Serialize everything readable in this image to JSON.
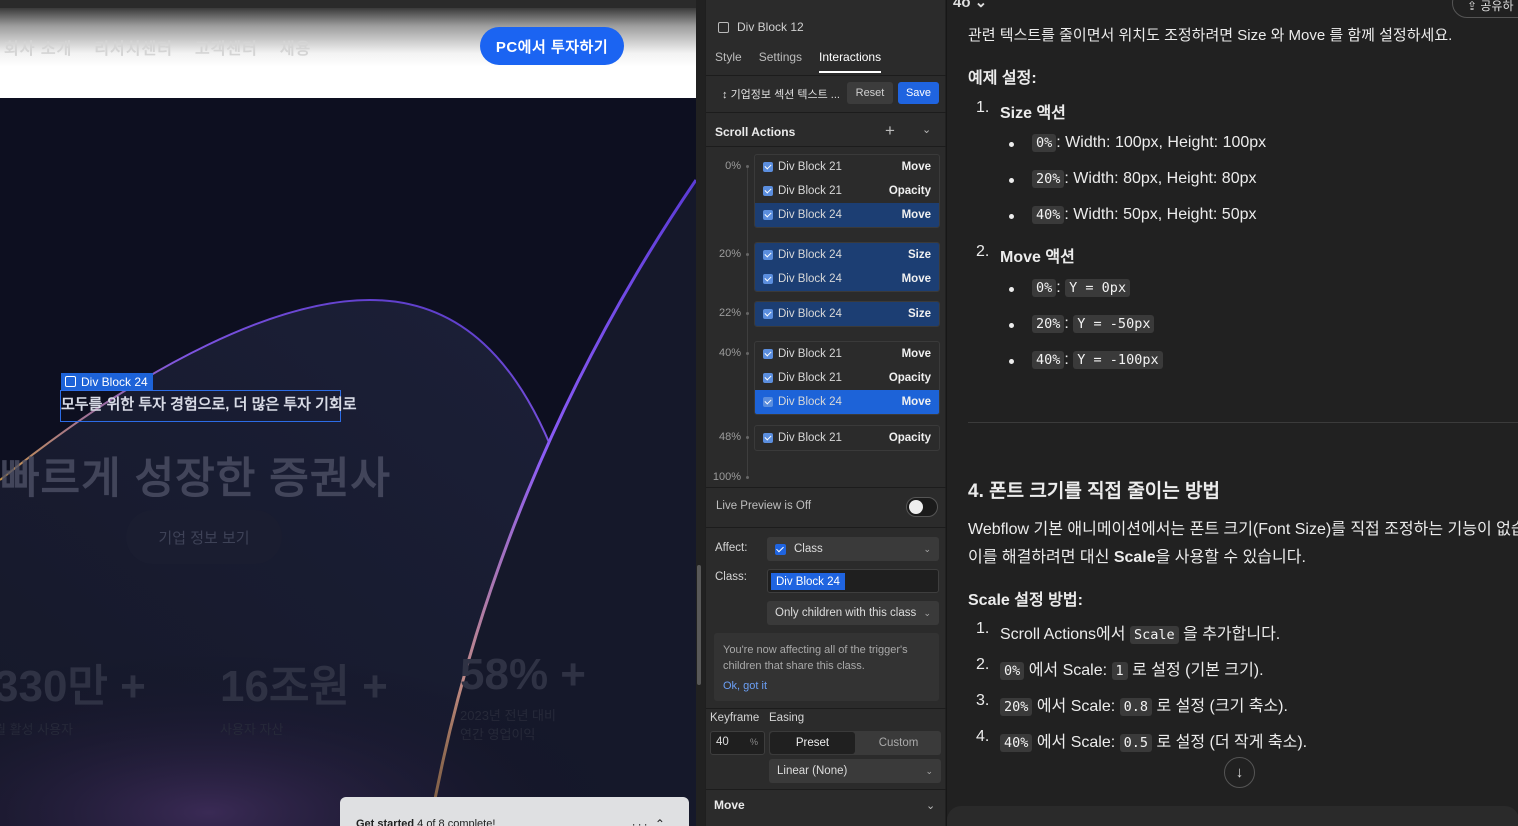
{
  "canvas": {
    "nav_links": [
      "회사 소개",
      "리서치센터",
      "고객센터",
      "채용"
    ],
    "cta_button": "PC에서 투자하기",
    "selection_tag": "Div Block 24",
    "hero_subtitle": "모두를 위한 투자 경험으로, 더 많은 투자 기회로",
    "hero_title": "빠르게 성장한 증권사",
    "hero_button": "기업 정보 보기",
    "stats": [
      {
        "num": "330만 +",
        "label": "월 활성 사용자"
      },
      {
        "num": "16조원 +",
        "label": "사용자 자산"
      },
      {
        "num": "58% +",
        "label": "2023년 전년 대비\n연간 영업이익"
      }
    ],
    "get_started": {
      "title": "Get started",
      "progress": "4 of 8 complete!"
    }
  },
  "panel": {
    "element_name": "Div Block 12",
    "tabs": [
      "Style",
      "Settings",
      "Interactions"
    ],
    "active_tab": "Interactions",
    "trigger_label": "기업정보 섹션 텍스트 ...",
    "reset": "Reset",
    "save": "Save",
    "scroll_actions_title": "Scroll Actions",
    "timeline": [
      {
        "pct": "0%",
        "rows": [
          {
            "name": "Div Block 21",
            "action": "Move",
            "state": ""
          },
          {
            "name": "Div Block 21",
            "action": "Opacity",
            "state": ""
          },
          {
            "name": "Div Block 24",
            "action": "Move",
            "state": "sel"
          }
        ]
      },
      {
        "pct": "20%",
        "rows": [
          {
            "name": "Div Block 24",
            "action": "Size",
            "state": "sel"
          },
          {
            "name": "Div Block 24",
            "action": "Move",
            "state": "sel"
          }
        ]
      },
      {
        "pct": "22%",
        "rows": [
          {
            "name": "Div Block 24",
            "action": "Size",
            "state": "sel"
          }
        ]
      },
      {
        "pct": "40%",
        "rows": [
          {
            "name": "Div Block 21",
            "action": "Move",
            "state": ""
          },
          {
            "name": "Div Block 21",
            "action": "Opacity",
            "state": ""
          },
          {
            "name": "Div Block 24",
            "action": "Move",
            "state": "sel2"
          }
        ]
      },
      {
        "pct": "48%",
        "rows": [
          {
            "name": "Div Block 21",
            "action": "Opacity",
            "state": ""
          }
        ]
      },
      {
        "pct": "100%",
        "rows": []
      }
    ],
    "live_preview": "Live Preview is Off",
    "affect_label": "Affect:",
    "affect_value": "Class",
    "class_label": "Class:",
    "class_value": "Div Block 24",
    "only_children": "Only children with this class",
    "note_text": "You're now affecting all of the trigger's children that share this class.",
    "note_link": "Ok, got it",
    "keyframe_label": "Keyframe",
    "easing_label": "Easing",
    "keyframe_value": "40",
    "keyframe_unit": "%",
    "easing_tabs": [
      "Preset",
      "Custom"
    ],
    "easing_value": "Linear (None)",
    "move_section": "Move"
  },
  "chat": {
    "top_left": "4o",
    "share": "공유하",
    "intro_line": "관련 텍스트를 줄이면서 위치도 조정하려면 Size 와 Move 를 함께 설정하세요.",
    "example_heading": "예제 설정:",
    "list1": [
      {
        "n": "1.",
        "title": "Size 액션",
        "items": [
          {
            "code": "0%",
            "text": ": Width: 100px, Height: 100px"
          },
          {
            "code": "20%",
            "text": ": Width: 80px, Height: 80px"
          },
          {
            "code": "40%",
            "text": ": Width: 50px, Height: 50px"
          }
        ]
      },
      {
        "n": "2.",
        "title": "Move 액션",
        "items": [
          {
            "code": "0%",
            "text": ":",
            "code2": "Y = 0px"
          },
          {
            "code": "20%",
            "text": ":",
            "code2": "Y = -50px"
          },
          {
            "code": "40%",
            "text": ":",
            "code2": "Y = -100px"
          }
        ]
      }
    ],
    "section4_title": "4. 폰트 크기를 직접 줄이는 방법",
    "section4_p1": "Webflow 기본 애니메이션에서는 폰트 크기(Font Size)를 직접 조정하는 기능이 없습니다.",
    "section4_p2_a": "이를 해결하려면 대신 ",
    "section4_p2_b": "Scale",
    "section4_p2_c": "을 사용할 수 있습니다.",
    "scale_heading": "Scale 설정 방법:",
    "scale_steps": [
      {
        "n": "1.",
        "pre": "Scroll Actions에서 ",
        "code": "Scale",
        "post": " 을 추가합니다."
      },
      {
        "n": "2.",
        "pre": "",
        "code": "0%",
        "mid": " 에서 Scale: ",
        "code2": "1",
        "post": " 로 설정 (기본 크기)."
      },
      {
        "n": "3.",
        "pre": "",
        "code": "20%",
        "mid": " 에서 Scale: ",
        "code2": "0.8",
        "post": " 로 설정 (크기 축소)."
      },
      {
        "n": "4.",
        "pre": "",
        "code": "40%",
        "mid": " 에서 Scale: ",
        "code2": "0.5",
        "post": " 로 설정 (더 작게 축소)."
      }
    ]
  },
  "icons": [
    "checkbox-icon",
    "plus-icon",
    "chevron-down-icon",
    "scroll-down-arrow-icon",
    "share-icon",
    "vertical-arrows-icon"
  ]
}
